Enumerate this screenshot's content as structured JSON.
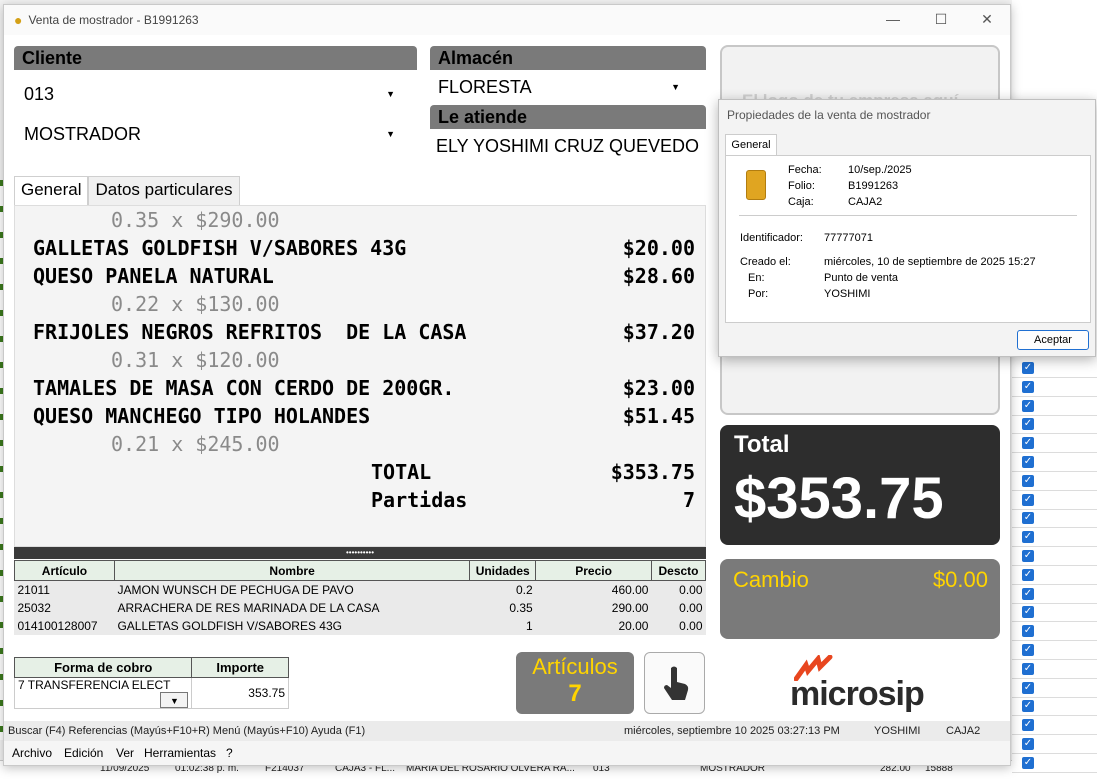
{
  "window": {
    "title": "Venta de mostrador - B1991263",
    "min": "—",
    "max": "☐",
    "close": "✕"
  },
  "cliente": {
    "label": "Cliente",
    "code": "013",
    "name": "MOSTRADOR"
  },
  "almacen": {
    "label": "Almacén",
    "value": "FLORESTA"
  },
  "atiende": {
    "label": "Le atiende",
    "value": "ELY YOSHIMI CRUZ QUEVEDO"
  },
  "tabs": [
    "General",
    "Datos particulares"
  ],
  "ticket": {
    "lines": [
      {
        "text": "0.35 x $290.00",
        "amount": "",
        "sub": true
      },
      {
        "text": "GALLETAS GOLDFISH V/SABORES 43G",
        "amount": "$20.00",
        "sub": false
      },
      {
        "text": "QUESO PANELA NATURAL",
        "amount": "$28.60",
        "sub": false
      },
      {
        "text": "0.22 x $130.00",
        "amount": "",
        "sub": true
      },
      {
        "text": "FRIJOLES NEGROS REFRITOS  DE LA CASA",
        "amount": "$37.20",
        "sub": false
      },
      {
        "text": "0.31 x $120.00",
        "amount": "",
        "sub": true
      },
      {
        "text": "TAMALES DE MASA CON CERDO DE 200GR.",
        "amount": "$23.00",
        "sub": false
      },
      {
        "text": "QUESO MANCHEGO TIPO HOLANDES",
        "amount": "$51.45",
        "sub": false
      },
      {
        "text": "0.21 x $245.00",
        "amount": "",
        "sub": true
      }
    ],
    "total_label": "TOTAL",
    "total_value": "$353.75",
    "partidas_label": "Partidas",
    "partidas_value": "7"
  },
  "grid": {
    "headers": [
      "Artículo",
      "Nombre",
      "Unidades",
      "Precio",
      "Descto"
    ],
    "rows": [
      [
        "21011",
        "JAMON WUNSCH DE PECHUGA DE PAVO",
        "0.2",
        "460.00",
        "0.00"
      ],
      [
        "25032",
        "ARRACHERA DE RES MARINADA DE LA CASA",
        "0.35",
        "290.00",
        "0.00"
      ],
      [
        "014100128007",
        "GALLETAS GOLDFISH V/SABORES 43G",
        "1",
        "20.00",
        "0.00"
      ]
    ]
  },
  "cobro": {
    "h1": "Forma de cobro",
    "h2": "Importe",
    "forma": "7 TRANSFERENCIA ELECT",
    "importe": "353.75"
  },
  "articulos": {
    "label": "Artículos",
    "value": "7"
  },
  "logo_hint": "El logo de tu empresa aquí",
  "total": {
    "label": "Total",
    "value": "$353.75"
  },
  "cambio": {
    "label": "Cambio",
    "value": "$0.00"
  },
  "brand": "microsip",
  "status": {
    "shortcuts": "Buscar (F4)  Referencias (Mayús+F10+R)  Menú (Mayús+F10)  Ayuda (F1)",
    "datetime": "miércoles, septiembre 10 2025 03:27:13 PM",
    "user": "YOSHIMI",
    "caja": "CAJA2"
  },
  "menu": [
    "Archivo",
    "Edición",
    "Ver",
    "Herramientas",
    "?"
  ],
  "props": {
    "title": "Propiedades de la venta de mostrador",
    "tab": "General",
    "fecha_l": "Fecha:",
    "fecha": "10/sep./2025",
    "folio_l": "Folio:",
    "folio": "B1991263",
    "caja_l": "Caja:",
    "caja": "CAJA2",
    "id_l": "Identificador:",
    "id": "77777071",
    "creado_l": "Creado el:",
    "creado": "miércoles, 10 de septiembre de 2025   15:27",
    "en_l": "En:",
    "en": "Punto de venta",
    "por_l": "Por:",
    "por": "YOSHIMI",
    "ok": "Aceptar"
  },
  "background": {
    "row": [
      "11/09/2025",
      "01:02:38 p. m.",
      "F214037",
      "CAJA3 - FL...",
      "MARIA DEL ROSARIO OLVERA RA...",
      "013",
      "MOSTRADOR",
      "282.00",
      "15888"
    ]
  }
}
